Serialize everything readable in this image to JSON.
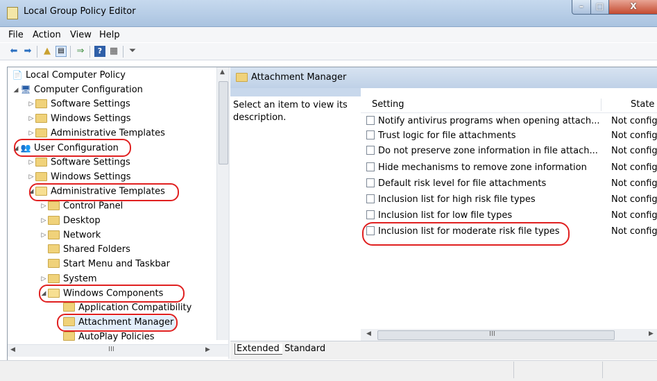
{
  "window": {
    "title": "Local Group Policy Editor",
    "controls": {
      "minimize": "–",
      "maximize": "□",
      "close": "X"
    }
  },
  "menu": [
    "File",
    "Action",
    "View",
    "Help"
  ],
  "toolbar": {
    "icons": [
      "back-arrow-icon",
      "forward-arrow-icon",
      "up-folder-icon",
      "show-hide-tree-icon",
      "export-list-icon",
      "help-icon",
      "properties-icon",
      "filter-icon"
    ]
  },
  "tree": {
    "root": "Local Computer Policy",
    "computer_configuration": "Computer Configuration",
    "cc_software_settings": "Software Settings",
    "cc_windows_settings": "Windows Settings",
    "cc_administrative_templates": "Administrative Templates",
    "user_configuration": "User Configuration",
    "uc_software_settings": "Software Settings",
    "uc_windows_settings": "Windows Settings",
    "uc_administrative_templates": "Administrative Templates",
    "control_panel": "Control Panel",
    "desktop": "Desktop",
    "network": "Network",
    "shared_folders": "Shared Folders",
    "start_menu": "Start Menu and Taskbar",
    "system": "System",
    "windows_components": "Windows Components",
    "application_compatibility": "Application Compatibility",
    "attachment_manager": "Attachment Manager",
    "autoplay_policies": "AutoPlay Policies"
  },
  "detail": {
    "header": "Attachment Manager",
    "description": "Select an item to view its description.",
    "columns": {
      "setting": "Setting",
      "state": "State"
    },
    "rows": [
      {
        "setting": "Notify antivirus programs when opening attach...",
        "state": "Not config"
      },
      {
        "setting": "Trust logic for file attachments",
        "state": "Not config"
      },
      {
        "setting": "Do not preserve zone information in file attach...",
        "state": "Not config"
      },
      {
        "setting": "Hide mechanisms to remove zone information",
        "state": "Not config"
      },
      {
        "setting": "Default risk level for file attachments",
        "state": "Not config"
      },
      {
        "setting": "Inclusion list for high risk file types",
        "state": "Not config"
      },
      {
        "setting": "Inclusion list for low file types",
        "state": "Not config"
      },
      {
        "setting": "Inclusion list for moderate risk file types",
        "state": "Not config"
      }
    ]
  },
  "tabs": {
    "extended": "Extended",
    "standard": "Standard"
  },
  "scrollbar_thumb": "III",
  "colors": {
    "annotation": "#e02020",
    "header_blue": "#c8d8ec"
  }
}
